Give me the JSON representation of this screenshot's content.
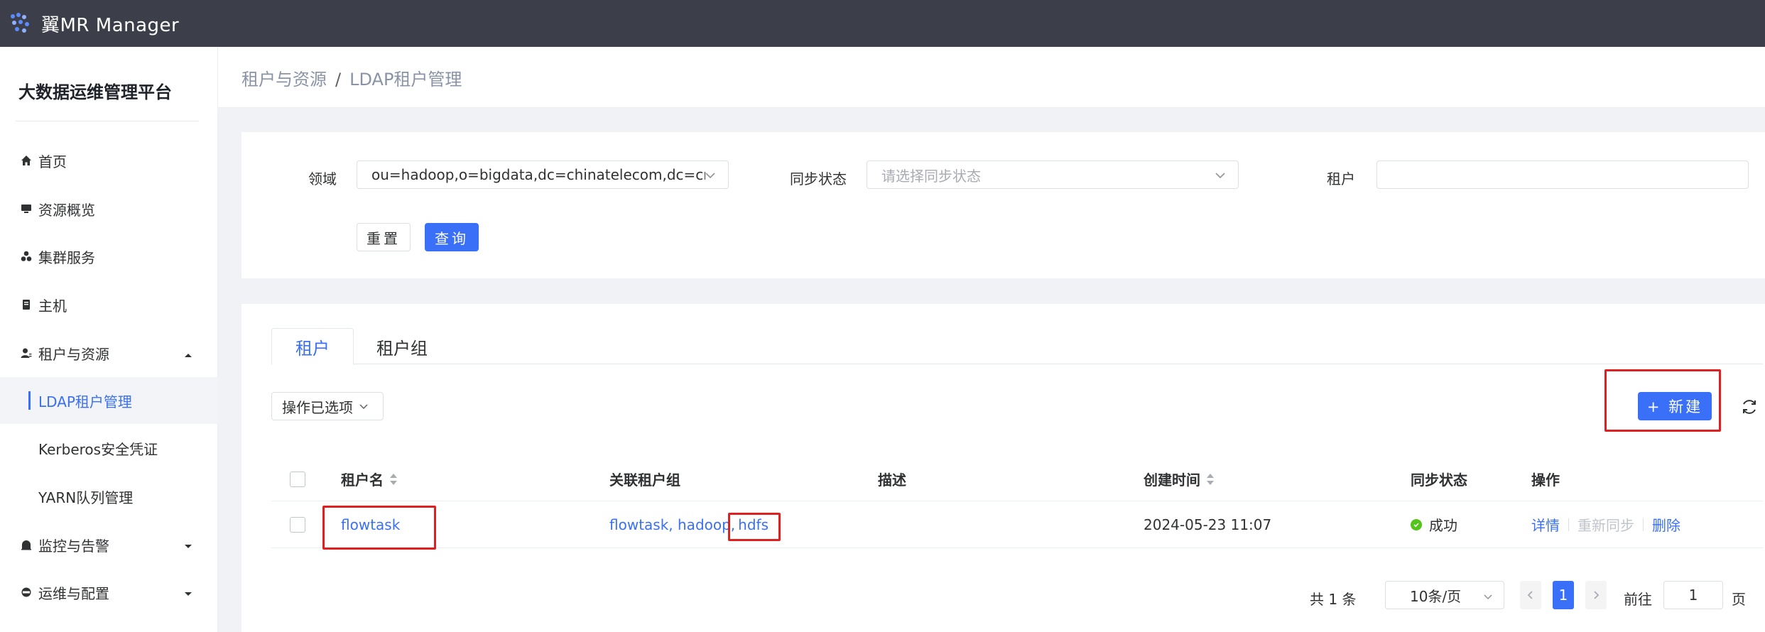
{
  "app": {
    "title": "翼MR Manager"
  },
  "sidebar": {
    "platform_title": "大数据运维管理平台",
    "items": [
      {
        "label": "首页",
        "icon": "home-icon"
      },
      {
        "label": "资源概览",
        "icon": "monitor-icon"
      },
      {
        "label": "集群服务",
        "icon": "cluster-icon"
      },
      {
        "label": "主机",
        "icon": "server-icon"
      },
      {
        "label": "租户与资源",
        "icon": "user-icon",
        "expanded": true
      },
      {
        "label": "LDAP租户管理",
        "sub": true,
        "active": true
      },
      {
        "label": "Kerberos安全凭证",
        "sub": true
      },
      {
        "label": "YARN队列管理",
        "sub": true
      },
      {
        "label": "监控与告警",
        "icon": "alarm-icon"
      },
      {
        "label": "运维与配置",
        "icon": "ops-icon"
      }
    ]
  },
  "breadcrumb": {
    "parent": "租户与资源",
    "sep": "/",
    "current": "LDAP租户管理"
  },
  "filters": {
    "domain_label": "领域",
    "domain_value": "ou=hadoop,o=bigdata,dc=chinatelecom,dc=cn",
    "sync_label": "同步状态",
    "sync_placeholder": "请选择同步状态",
    "tenant_label": "租户",
    "tenant_value": "",
    "reset_label": "重置",
    "query_label": "查询"
  },
  "tabs": [
    {
      "label": "租户",
      "active": true
    },
    {
      "label": "租户组"
    }
  ],
  "toolbar": {
    "bulk_label": "操作已选项",
    "new_label": "+ 新建"
  },
  "table": {
    "columns": [
      "租户名",
      "关联租户组",
      "描述",
      "创建时间",
      "同步状态",
      "操作"
    ],
    "rows": [
      {
        "name": "flowtask",
        "groups_prefix": "flowtask, hadoop,",
        "groups_highlight": "hdfs",
        "desc": "",
        "created": "2024-05-23 11:07",
        "status": "成功",
        "ops": {
          "detail": "详情",
          "resync": "重新同步",
          "delete": "删除"
        }
      }
    ]
  },
  "pager": {
    "total": "共 1 条",
    "size": "10条/页",
    "current": "1",
    "goto_label": "前往",
    "goto_value": "1",
    "page_unit": "页"
  },
  "colors": {
    "primary": "#3a6ff7",
    "topbar": "#3c3f4a",
    "highlight": "#e02020",
    "success": "#52c41a"
  }
}
